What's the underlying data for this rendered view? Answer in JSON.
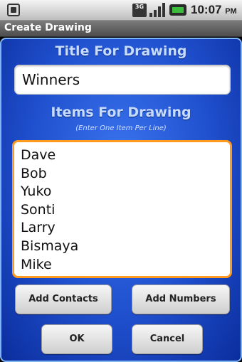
{
  "status_bar": {
    "network_label": "3G",
    "time": "10:07",
    "time_period": "PM"
  },
  "window": {
    "title": "Create Drawing"
  },
  "form": {
    "title_heading": "Title For Drawing",
    "title_value": "Winners",
    "items_heading": "Items For Drawing",
    "items_hint": "(Enter One Item Per Line)",
    "items": [
      "Dave",
      "Bob",
      "Yuko",
      "Sonti",
      "Larry",
      "Bismaya",
      "Mike"
    ]
  },
  "buttons": {
    "add_contacts": "Add Contacts",
    "add_numbers": "Add Numbers",
    "ok": "OK",
    "cancel": "Cancel"
  },
  "colors": {
    "panel_blue": "#1f4fcd",
    "focus_orange": "#ff9a1f",
    "battery_green": "#3cbd3c"
  }
}
